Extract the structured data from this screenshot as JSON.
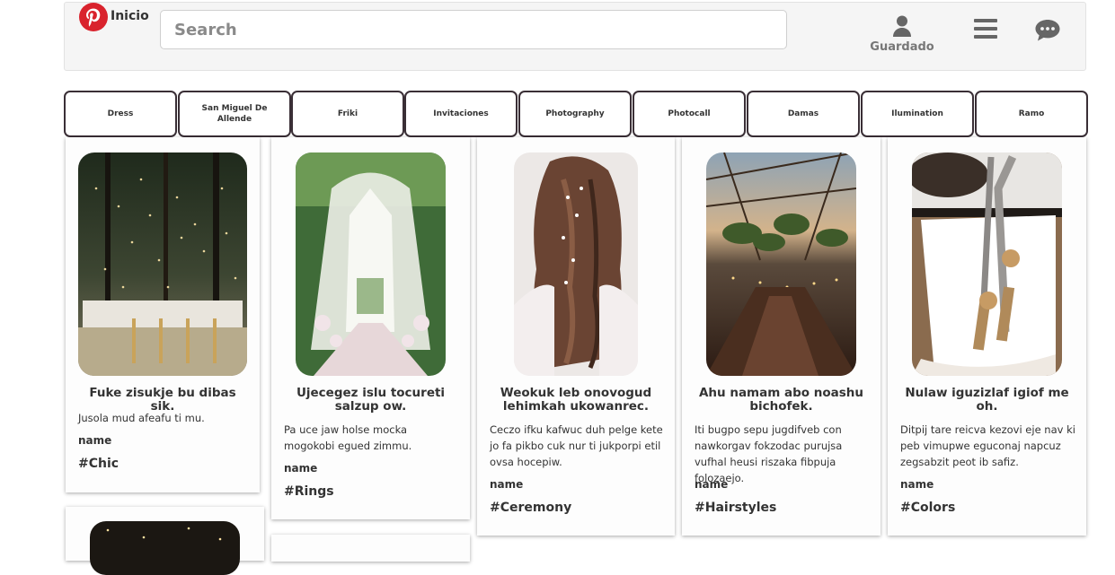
{
  "header": {
    "home_label": "Inicio",
    "search_placeholder": "Search",
    "saved_label": "Guardado"
  },
  "icons": {
    "logo": "pinterest-logo",
    "saved": "user-icon",
    "menu": "hamburger-menu-icon",
    "chat": "chat-icon"
  },
  "colors": {
    "brand": "#d9232d",
    "header_bg": "#f5f5f5",
    "category_border": "#3a2f36",
    "icon_gray": "#666666"
  },
  "categories": [
    "Dress",
    "San Miguel De Allende",
    "Friki",
    "Invitaciones",
    "Photography",
    "Photocall",
    "Damas",
    "Ilumination",
    "Ramo"
  ],
  "cards": [
    {
      "title": "Fuke zisukje bu dibas sik.",
      "description": "Jusola mud afeafu ti mu.",
      "name_label": "name",
      "tag": "#Chic"
    },
    {
      "title": "Ujecegez islu tocureti salzup ow.",
      "description": "Pa uce jaw holse mocka mogokobi egued zimmu.",
      "name_label": "name",
      "tag": "#Rings"
    },
    {
      "title": "Weokuk leb onovogud lehimkah ukowanrec.",
      "description": "Ceczo ifku kafwuc duh pelge kete jo fa pikbo cuk nur ti jukporpi etil ovsa hocepiw.",
      "name_label": "name",
      "tag": "#Ceremony"
    },
    {
      "title": "Ahu namam abo noashu bichofek.",
      "description": "Iti bugpo sepu jugdifveb con nawkorgav fokzodac purujsa vufhal heusi riszaka fibpuja folozaejo.",
      "name_label": "name",
      "tag": "#Hairstyles"
    },
    {
      "title": "Nulaw iguzizlaf igiof me oh.",
      "description": "Ditpij tare reicva kezovi eje nav ki peb vimupwe eguconaj napcuz zegsabzit peot ib safiz.",
      "name_label": "name",
      "tag": "#Colors"
    }
  ]
}
